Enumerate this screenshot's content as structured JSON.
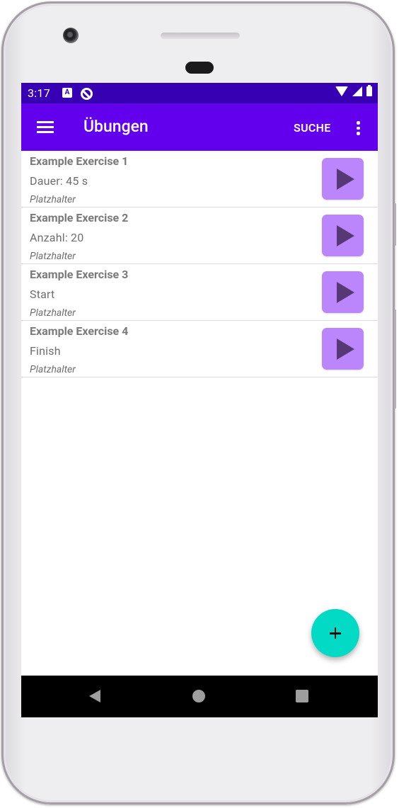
{
  "status_bar": {
    "time": "3:17",
    "notification_icon_letter": "A"
  },
  "app_bar": {
    "title": "Übungen",
    "search_action": "SUCHE"
  },
  "exercises": [
    {
      "name": "Example Exercise 1",
      "detail": "Dauer: 45 s",
      "note": "Platzhalter"
    },
    {
      "name": "Example Exercise 2",
      "detail": "Anzahl: 20",
      "note": "Platzhalter"
    },
    {
      "name": "Example Exercise 3",
      "detail": "Start",
      "note": "Platzhalter"
    },
    {
      "name": "Example Exercise 4",
      "detail": "Finish",
      "note": "Platzhalter"
    }
  ],
  "colors": {
    "status_bar": "#3700b3",
    "primary": "#6200ee",
    "play_button": "#bb86fc",
    "play_icon": "#563875",
    "fab": "#03dac5"
  },
  "icons": {
    "menu": "hamburger-menu-icon",
    "overflow": "more-vert-icon",
    "play": "play-icon",
    "fab": "add-icon",
    "nav_back": "back-triangle-icon",
    "nav_home": "home-circle-icon",
    "nav_recents": "recents-square-icon"
  }
}
